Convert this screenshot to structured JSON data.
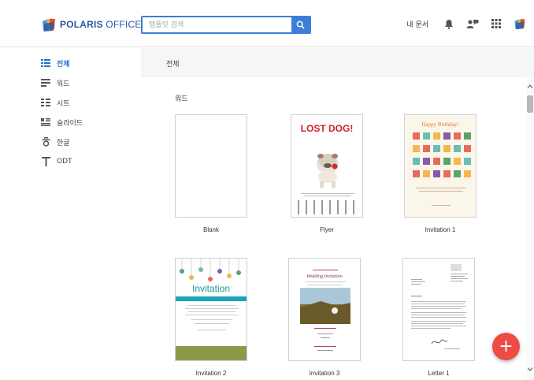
{
  "window": {
    "help": "?",
    "minimize": "–",
    "maximize": "□",
    "close": "×"
  },
  "header": {
    "logo_bold": "POLARIS",
    "logo_light": " OFFICE",
    "search_placeholder": "템플릿 검색",
    "my_documents": "내 문서"
  },
  "sidebar": {
    "items": [
      {
        "label": "전체",
        "icon": "all-list-icon"
      },
      {
        "label": "워드",
        "icon": "word-doc-icon"
      },
      {
        "label": "시트",
        "icon": "sheet-icon"
      },
      {
        "label": "슬라이드",
        "icon": "slide-icon"
      },
      {
        "label": "한글",
        "icon": "hangul-icon"
      },
      {
        "label": "ODT",
        "icon": "odt-icon"
      }
    ]
  },
  "content": {
    "title": "전체",
    "section": "워드",
    "templates": [
      {
        "label": "Blank"
      },
      {
        "label": "Flyer",
        "headline": "LOST DOG!"
      },
      {
        "label": "Invitation 1",
        "headline": "Happy Birthday!"
      },
      {
        "label": "Invitation 2",
        "headline": "Invitation"
      },
      {
        "label": "Invitation 3",
        "headline": "Wedding Invitation"
      },
      {
        "label": "Letter 1"
      }
    ]
  },
  "fab": {
    "symbol": "+"
  },
  "colors": {
    "accent": "#3d7fd8",
    "active_nav": "#2a6fcf",
    "fab": "#ef4b45",
    "logo": "#2a58a6"
  }
}
